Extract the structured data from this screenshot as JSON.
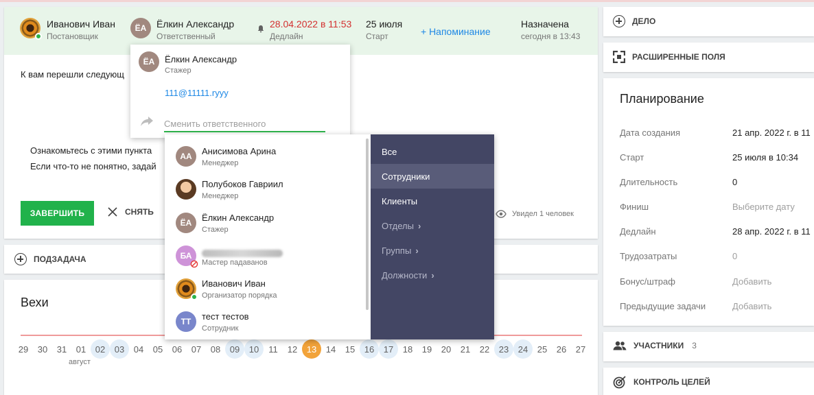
{
  "header": {
    "author": {
      "name": "Иванович Иван",
      "role": "Постановщик"
    },
    "responsible": {
      "name": "Ёлкин Александр",
      "role": "Ответственный",
      "initials": "ЁА"
    },
    "deadline": {
      "value": "28.04.2022 в 11:53",
      "label": "Дедлайн"
    },
    "start": {
      "value": "25 июля",
      "label": "Старт"
    },
    "reminder": "+ Напоминание",
    "status": {
      "value": "Назначена",
      "time": "сегодня в 13:43"
    }
  },
  "message": {
    "intro": "К вам перешли следующ",
    "line1": "Ознакомьтесь с этими пункта",
    "line2": "Если что-то не понятно, задай"
  },
  "actions": {
    "complete": "ЗАВЕРШИТЬ",
    "remove": "СНЯТЬ",
    "seen": "Увидел 1 человек"
  },
  "subtask": "ПОДЗАДАЧА",
  "milestones": {
    "title": "Вехи",
    "days": [
      "29",
      "30",
      "31",
      "01",
      "02",
      "03",
      "04",
      "05",
      "06",
      "07",
      "08",
      "09",
      "10",
      "11",
      "12",
      "13",
      "14",
      "15",
      "16",
      "17",
      "18",
      "19",
      "20",
      "21",
      "22",
      "23",
      "24",
      "25",
      "26",
      "27"
    ],
    "highlighted": [
      "02",
      "03",
      "09",
      "10",
      "16",
      "17",
      "23",
      "24"
    ],
    "today": "13",
    "month_label": "август"
  },
  "popup": {
    "person": {
      "name": "Ёлкин Александр",
      "role": "Стажер",
      "initials": "ЁА"
    },
    "email": "111@11111.ryyy",
    "input_placeholder": "Сменить ответственного"
  },
  "people": [
    {
      "name": "Анисимова Арина",
      "role": "Менеджер",
      "initials": "АА",
      "color": "#a1887f"
    },
    {
      "name": "Полубоков Гавриил",
      "role": "Менеджер",
      "initials": "",
      "color": "#8d6e63"
    },
    {
      "name": "Ёлкин Александр",
      "role": "Стажер",
      "initials": "ЁА",
      "color": "#a1887f"
    },
    {
      "name": "",
      "role": "Мастер падаванов",
      "initials": "БА",
      "color": "#ce93d8"
    },
    {
      "name": "Иванович Иван",
      "role": "Организатор порядка",
      "initials": "",
      "color": "#e08a1c"
    },
    {
      "name": "тест тестов",
      "role": "Сотрудник",
      "initials": "ТТ",
      "color": "#7986cb"
    }
  ],
  "filters": [
    {
      "label": "Все"
    },
    {
      "label": "Сотрудники"
    },
    {
      "label": "Клиенты"
    },
    {
      "label": "Отделы"
    },
    {
      "label": "Группы"
    },
    {
      "label": "Должности"
    }
  ],
  "right": {
    "case": "ДЕЛО",
    "extended_fields": "РАСШИРЕННЫЕ ПОЛЯ",
    "planning": {
      "title": "Планирование",
      "rows": [
        {
          "label": "Дата создания",
          "value": "21 апр. 2022 г. в 11"
        },
        {
          "label": "Старт",
          "value": "25 июля в 10:34"
        },
        {
          "label": "Длительность",
          "value": "0"
        },
        {
          "label": "Финиш",
          "value": "Выберите дату"
        },
        {
          "label": "Дедлайн",
          "value": "28 апр. 2022 г. в 11"
        },
        {
          "label": "Трудозатраты",
          "value": "0"
        },
        {
          "label": "Бонус/штраф",
          "value": "Добавить"
        },
        {
          "label": "Предыдущие задачи",
          "value": "Добавить"
        }
      ]
    },
    "participants": {
      "label": "УЧАСТНИКИ",
      "count": "3"
    },
    "goals": "КОНТРОЛЬ ЦЕЛЕЙ"
  },
  "colors": {
    "accent_green": "#21b24b",
    "header_bg": "#e8f5e9",
    "filter_panel": "#434664",
    "deadline_red": "#d32f2f",
    "today": "#f2a33a"
  }
}
